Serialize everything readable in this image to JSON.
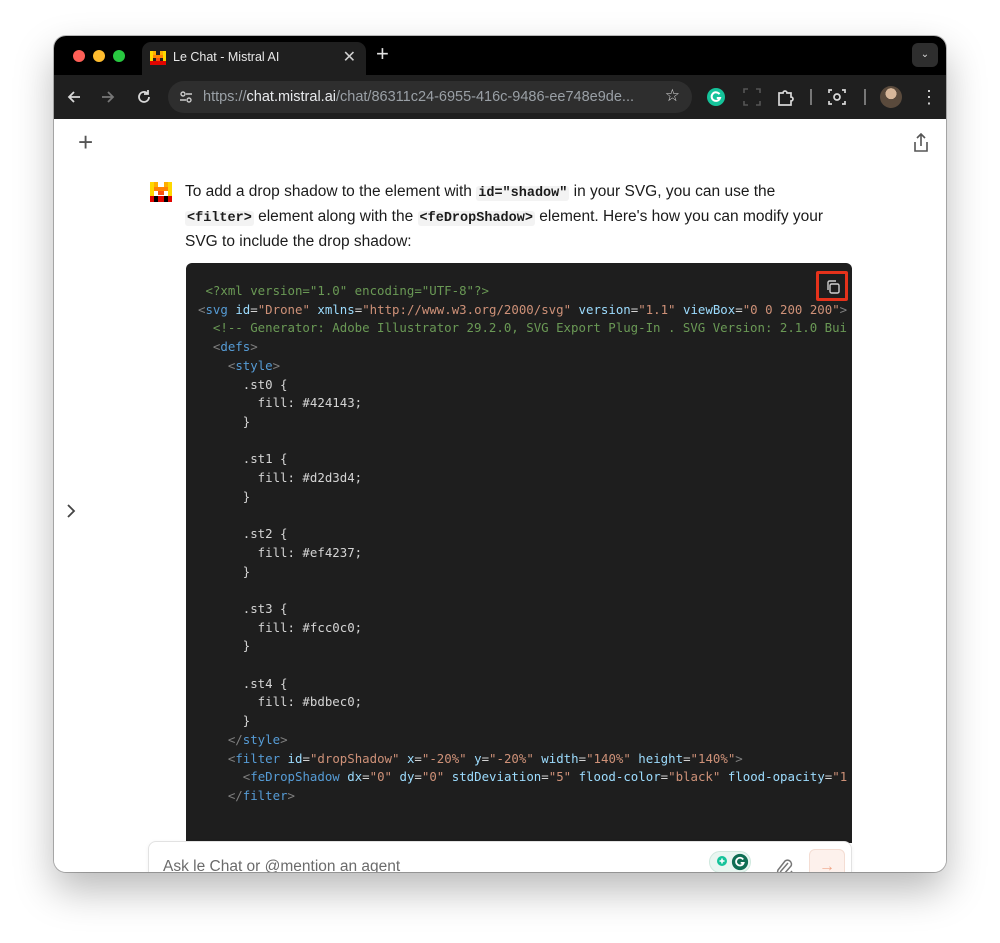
{
  "browser": {
    "tab_title": "Le Chat - Mistral AI",
    "tab_close": "✕",
    "new_tab": "+",
    "tab_menu": "⌄",
    "url_prefix": "https://",
    "url_host": "chat.mistral.ai",
    "url_path": "/chat/86311c24-6955-416c-9486-ee748e9de...",
    "icons": [
      "back-icon",
      "forward-icon",
      "reload-icon",
      "site-settings-icon",
      "bookmark-star-icon",
      "grammarly-icon",
      "extension-puzzle-icon",
      "screenshot-icon",
      "profile-avatar",
      "more-menu-icon"
    ]
  },
  "chat": {
    "new_chat": "+",
    "message": {
      "part1": "To add a drop shadow to the element with ",
      "code1": "id=\"shadow\"",
      "part2": " in your SVG, you can use the ",
      "code2": "<filter>",
      "part3": " element along with the ",
      "code3": "<feDropShadow>",
      "part4": " element. Here's how you can modify your SVG to include the drop shadow:"
    },
    "code_lines": [
      " <?xml version=\"1.0\" encoding=\"UTF-8\"?>",
      "<svg id=\"Drone\" xmlns=\"http://www.w3.org/2000/svg\" version=\"1.1\" viewBox=\"0 0 200 200\">",
      "  <!-- Generator: Adobe Illustrator 29.2.0, SVG Export Plug-In . SVG Version: 2.1.0 Bui",
      "  <defs>",
      "    <style>",
      "      .st0 {",
      "        fill: #424143;",
      "      }",
      "",
      "      .st1 {",
      "        fill: #d2d3d4;",
      "      }",
      "",
      "      .st2 {",
      "        fill: #ef4237;",
      "      }",
      "",
      "      .st3 {",
      "        fill: #fcc0c0;",
      "      }",
      "",
      "      .st4 {",
      "        fill: #bdbec0;",
      "      }",
      "    </style>",
      "    <filter id=\"dropShadow\" x=\"-20%\" y=\"-20%\" width=\"140%\" height=\"140%\">",
      "      <feDropShadow dx=\"0\" dy=\"0\" stdDeviation=\"5\" flood-color=\"black\" flood-opacity=\"1",
      "    </filter>"
    ],
    "input_placeholder": "Ask le Chat or @mention an agent",
    "send_arrow": "→"
  },
  "colors": {
    "brand_orange": "#fa520f",
    "copy_highlight": "#e5321b",
    "code_bg": "#1e1e1e"
  }
}
